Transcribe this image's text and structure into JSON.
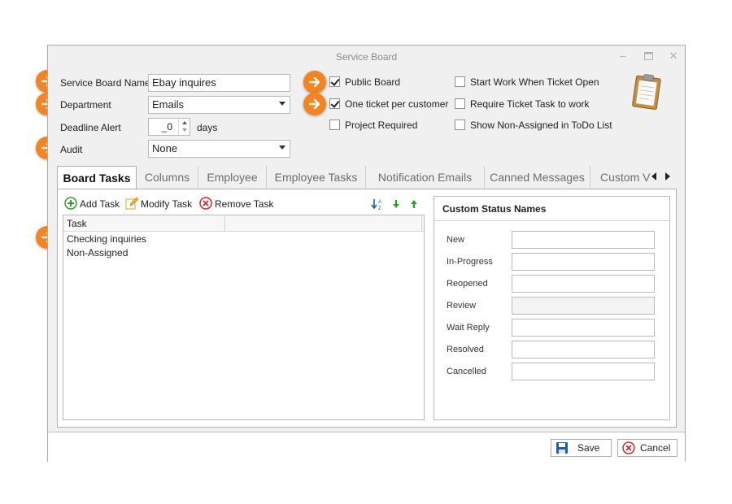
{
  "window": {
    "title": "Service Board"
  },
  "form": {
    "board_name_label": "Service Board Name",
    "board_name_value": "Ebay inquires",
    "department_label": "Department",
    "department_value": "Emails",
    "deadline_label": "Deadline Alert",
    "deadline_value": "_0",
    "deadline_unit": "days",
    "audit_label": "Audit",
    "audit_value": "None"
  },
  "options": [
    {
      "label": "Public Board",
      "checked": true
    },
    {
      "label": "One ticket per customer",
      "checked": true
    },
    {
      "label": "Project Required",
      "checked": false
    },
    {
      "label": "Start Work When Ticket Open",
      "checked": false
    },
    {
      "label": "Require Ticket Task to work",
      "checked": false
    },
    {
      "label": "Show Non-Assigned in ToDo List",
      "checked": false
    }
  ],
  "tabs": [
    "Board Tasks",
    "Columns",
    "Employee",
    "Employee Tasks",
    "Notification Emails",
    "Canned Messages",
    "Custom V"
  ],
  "active_tab": "Board Tasks",
  "task_toolbar": {
    "add": "Add Task",
    "modify": "Modify Task",
    "remove": "Remove Task"
  },
  "task_grid": {
    "column": "Task",
    "rows": [
      "Checking inquiries",
      "Non-Assigned"
    ]
  },
  "status_names": {
    "title": "Custom Status Names",
    "items": [
      "New",
      "In-Progress",
      "Reopened",
      "Review",
      "Wait Reply",
      "Resolved",
      "Cancelled"
    ]
  },
  "footer": {
    "save": "Save",
    "cancel": "Cancel"
  },
  "colors": {
    "callout_orange": "#f5831f",
    "add_green": "#2ea02e",
    "remove_red": "#d62b2b",
    "save_blue": "#1f5fa8"
  }
}
